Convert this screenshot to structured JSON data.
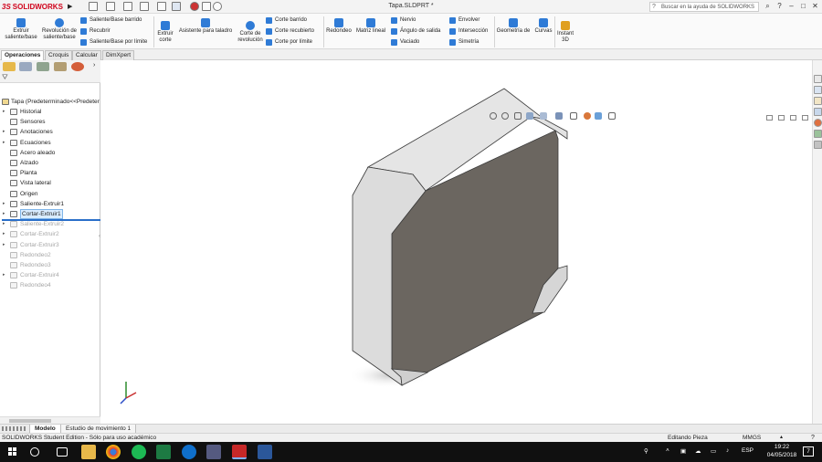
{
  "app": {
    "logo_text": "SOLIDWORKS",
    "logo_ds": "3S",
    "document_title": "Tapa.SLDPRT *",
    "help_search_placeholder": "Buscar en la ayuda de SOLIDWORKS",
    "window_buttons": [
      "?",
      "–",
      "□",
      "✕"
    ]
  },
  "ribbon": {
    "big_buttons": [
      {
        "id": "extruir-saliente",
        "label": "Extruir saliente/base",
        "color": "#2f7bd6"
      },
      {
        "id": "revolucion-saliente",
        "label": "Revolución de saliente/base",
        "color": "#2f7bd6"
      },
      {
        "id": "extruir-corte",
        "label": "Extruir corte",
        "color": "#2f7bd6"
      },
      {
        "id": "asistente-taladro",
        "label": "Asistente para taladro",
        "color": "#2f7bd6"
      },
      {
        "id": "corte-revolucion",
        "label": "Corte de revolución",
        "color": "#2f7bd6"
      },
      {
        "id": "redondeo",
        "label": "Redondeo",
        "color": "#2f7bd6"
      },
      {
        "id": "matriz-lineal",
        "label": "Matriz lineal",
        "color": "#2f7bd6"
      },
      {
        "id": "geometria-ref",
        "label": "Geometría de",
        "color": "#2f7bd6"
      },
      {
        "id": "curvas",
        "label": "Curvas",
        "color": "#2f7bd6"
      },
      {
        "id": "instant-3d",
        "label": "Instant 3D",
        "color": "#e0a020"
      }
    ],
    "small_buttons_col1": [
      "Saliente/Base barrido",
      "Recubrir",
      "Saliente/Base por límite"
    ],
    "small_buttons_col2": [
      "Corte barrido",
      "Corte recubierto",
      "Corte por límite"
    ],
    "small_buttons_col3": [
      "Nervio",
      "Ángulo de salida",
      "Vaciado"
    ],
    "small_buttons_col4": [
      "Envolver",
      "Intersección",
      "Simetría"
    ]
  },
  "tabs": [
    "Operaciones",
    "Croquis",
    "Calcular",
    "DimXpert"
  ],
  "tree": {
    "root_label": "Tapa  (Predeterminado<<Predeter",
    "items": [
      {
        "label": "Historial",
        "arrow": true,
        "state": "normal"
      },
      {
        "label": "Sensores",
        "arrow": false,
        "state": "normal"
      },
      {
        "label": "Anotaciones",
        "arrow": true,
        "state": "normal"
      },
      {
        "label": "Ecuaciones",
        "arrow": true,
        "state": "normal"
      },
      {
        "label": "Acero aleado",
        "arrow": false,
        "state": "normal"
      },
      {
        "label": "Alzado",
        "arrow": false,
        "state": "normal"
      },
      {
        "label": "Planta",
        "arrow": false,
        "state": "normal"
      },
      {
        "label": "Vista lateral",
        "arrow": false,
        "state": "normal"
      },
      {
        "label": "Origen",
        "arrow": false,
        "state": "normal"
      },
      {
        "label": "Saliente-Extruir1",
        "arrow": true,
        "state": "normal"
      },
      {
        "label": "Cortar-Extruir1",
        "arrow": true,
        "state": "selected"
      },
      {
        "label": "Saliente-Extruir2",
        "arrow": true,
        "state": "dim"
      },
      {
        "label": "Cortar-Extruir2",
        "arrow": true,
        "state": "dim"
      },
      {
        "label": "Cortar-Extruir3",
        "arrow": true,
        "state": "dim"
      },
      {
        "label": "Redondeo2",
        "arrow": false,
        "state": "dim"
      },
      {
        "label": "Redondeo3",
        "arrow": false,
        "state": "dim"
      },
      {
        "label": "Cortar-Extruir4",
        "arrow": true,
        "state": "dim"
      },
      {
        "label": "Redondeo4",
        "arrow": false,
        "state": "dim"
      }
    ]
  },
  "bottom_tabs": [
    "Modelo",
    "Estudio de movimiento 1"
  ],
  "statusbar": {
    "left": "SOLIDWORKS Student Edition - Sólo para uso académico",
    "mode": "Editando Pieza",
    "units": "MMGS"
  },
  "taskbar": {
    "language": "ESP",
    "time": "19:22",
    "date": "04/05/2018",
    "notifications": "7"
  },
  "colors": {
    "accent_blue": "#2f7bd6",
    "brand_red": "#d0021b",
    "model_face_dark": "#6b6660",
    "model_face_light": "#dcdcdc"
  }
}
